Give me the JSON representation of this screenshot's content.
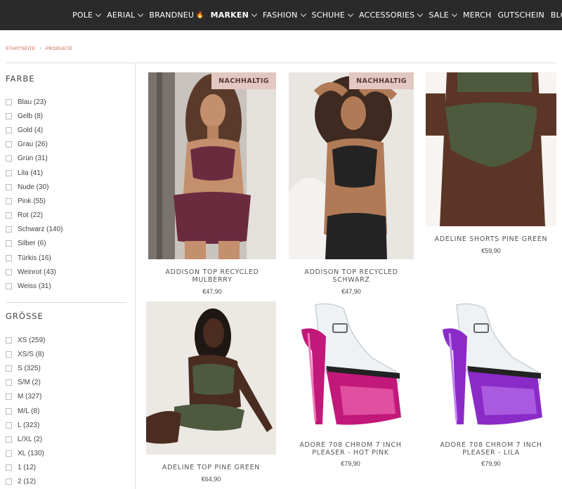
{
  "nav": {
    "items": [
      {
        "label": "POLE",
        "chevron": true,
        "bold": false
      },
      {
        "label": "AERIAL",
        "chevron": true,
        "bold": false
      },
      {
        "label": "BRANDNEU",
        "chevron": false,
        "bold": false,
        "flame": true
      },
      {
        "label": "MARKEN",
        "chevron": true,
        "bold": true
      },
      {
        "label": "FASHION",
        "chevron": true,
        "bold": false
      },
      {
        "label": "SCHUHE",
        "chevron": true,
        "bold": false
      },
      {
        "label": "ACCESSORIES",
        "chevron": true,
        "bold": false
      },
      {
        "label": "SALE",
        "chevron": true,
        "bold": false
      },
      {
        "label": "MERCH",
        "chevron": false,
        "bold": false
      },
      {
        "label": "GUTSCHEIN",
        "chevron": false,
        "bold": false
      },
      {
        "label": "BLOG",
        "chevron": false,
        "bold": false
      }
    ]
  },
  "breadcrumb": {
    "home": "STARTSEITE",
    "separator": "/",
    "current": "PRODUKTE"
  },
  "filters": {
    "farbe": {
      "title": "FARBE",
      "options": [
        "Blau (23)",
        "Gelb (8)",
        "Gold (4)",
        "Grau (26)",
        "Grün (31)",
        "Lila (41)",
        "Nude (30)",
        "Pink (55)",
        "Rot (22)",
        "Schwarz (140)",
        "Silber (6)",
        "Türkis (16)",
        "Weinrot (43)",
        "Weiss (31)"
      ]
    },
    "groesse": {
      "title": "GRÖSSE",
      "options": [
        "XS (259)",
        "XS/S (8)",
        "S (325)",
        "S/M (2)",
        "M (327)",
        "M/L (8)",
        "L (323)",
        "L/XL (2)",
        "XL (130)",
        "1 (12)",
        "2 (12)"
      ]
    }
  },
  "products": [
    {
      "name": "ADDISON TOP RECYCLED MULBERRY",
      "price": "€47,90",
      "badge": "NACHHALTIG",
      "image": "model-mulberry-bikini"
    },
    {
      "name": "ADDISON TOP RECYCLED SCHWARZ",
      "price": "€47,90",
      "badge": "NACHHALTIG",
      "image": "model-black-bikini"
    },
    {
      "name": "ADELINE SHORTS PINE GREEN",
      "price": "€59,90",
      "badge": "",
      "image": "green-shorts"
    },
    {
      "name": "ADELINE TOP PINE GREEN",
      "price": "€64,90",
      "badge": "",
      "image": "model-green-set"
    },
    {
      "name": "ADORE 708 CHROM 7 INCH PLEASER - HOT PINK",
      "price": "€79,90",
      "badge": "",
      "image": "pink-platform-heel"
    },
    {
      "name": "ADORE 708 CHROM 7 INCH PLEASER - LILA",
      "price": "€79,90",
      "badge": "",
      "image": "purple-platform-heel"
    }
  ],
  "colors": {
    "nav_bg": "#2a2a2a",
    "badge_bg": "#e3c7c1",
    "breadcrumb": "#c55a3d",
    "pink_chrome": "#c2187a",
    "lila_chrome": "#8a2bc8",
    "pine_green": "#4d5a3e",
    "mulberry": "#6b2b3f"
  }
}
